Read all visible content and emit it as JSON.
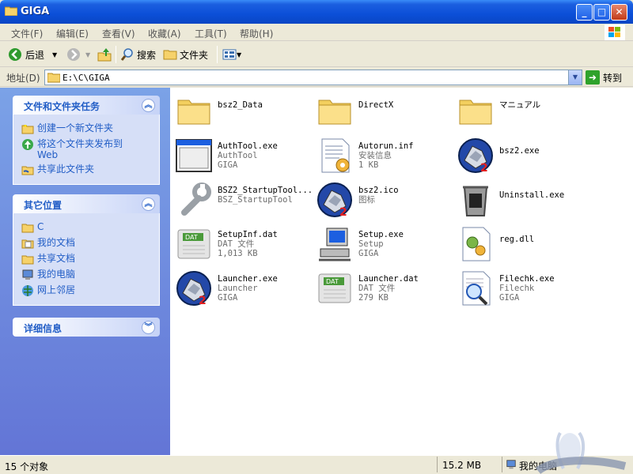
{
  "window": {
    "title": "GIGA"
  },
  "menu": [
    "文件(F)",
    "编辑(E)",
    "查看(V)",
    "收藏(A)",
    "工具(T)",
    "帮助(H)"
  ],
  "toolbar": {
    "back": "后退",
    "search": "搜索",
    "folders": "文件夹"
  },
  "address": {
    "label": "地址(D)",
    "value": "E:\\C\\GIGA",
    "go": "转到"
  },
  "tasks": {
    "title": "文件和文件夹任务",
    "items": [
      "创建一个新文件夹",
      "将这个文件夹发布到\nWeb",
      "共享此文件夹"
    ]
  },
  "places": {
    "title": "其它位置",
    "items": [
      "C",
      "我的文档",
      "共享文档",
      "我的电脑",
      "网上邻居"
    ]
  },
  "details": {
    "title": "详细信息"
  },
  "files": [
    {
      "name": "bsz2_Data",
      "sub1": "",
      "sub2": "",
      "icon": "folder-icon"
    },
    {
      "name": "DirectX",
      "sub1": "",
      "sub2": "",
      "icon": "folder-icon"
    },
    {
      "name": "マニュアル",
      "sub1": "",
      "sub2": "",
      "icon": "folder-icon"
    },
    {
      "name": "AuthTool.exe",
      "sub1": "AuthTool",
      "sub2": "GIGA",
      "icon": "window-app-icon"
    },
    {
      "name": "Autorun.inf",
      "sub1": "安装信息",
      "sub2": "1 KB",
      "icon": "setup-info-icon"
    },
    {
      "name": "bsz2.exe",
      "sub1": "",
      "sub2": "",
      "icon": "bsz2-app-icon"
    },
    {
      "name": "BSZ2_StartupTool...",
      "sub1": "BSZ_StartupTool",
      "sub2": "",
      "icon": "wrench-icon"
    },
    {
      "name": "bsz2.ico",
      "sub1": "图标",
      "sub2": "",
      "icon": "bsz2-app-icon"
    },
    {
      "name": "Uninstall.exe",
      "sub1": "",
      "sub2": "",
      "icon": "trash-icon"
    },
    {
      "name": "SetupInf.dat",
      "sub1": "DAT 文件",
      "sub2": "1,013 KB",
      "icon": "dat-file-icon"
    },
    {
      "name": "Setup.exe",
      "sub1": "Setup",
      "sub2": "GIGA",
      "icon": "computer-setup-icon"
    },
    {
      "name": "reg.dll",
      "sub1": "",
      "sub2": "",
      "icon": "dll-file-icon"
    },
    {
      "name": "Launcher.exe",
      "sub1": "Launcher",
      "sub2": "GIGA",
      "icon": "bsz2-app-icon"
    },
    {
      "name": "Launcher.dat",
      "sub1": "DAT 文件",
      "sub2": "279 KB",
      "icon": "dat-file-icon"
    },
    {
      "name": "Filechk.exe",
      "sub1": "Filechk",
      "sub2": "GIGA",
      "icon": "magnifier-doc-icon"
    }
  ],
  "status": {
    "count": "15 个对象",
    "size": "15.2 MB",
    "location": "我的电脑"
  },
  "colors": {
    "accent": "#215dc6",
    "titlebar": "#0b4fd8",
    "taskpane": "#7ba2e7"
  }
}
